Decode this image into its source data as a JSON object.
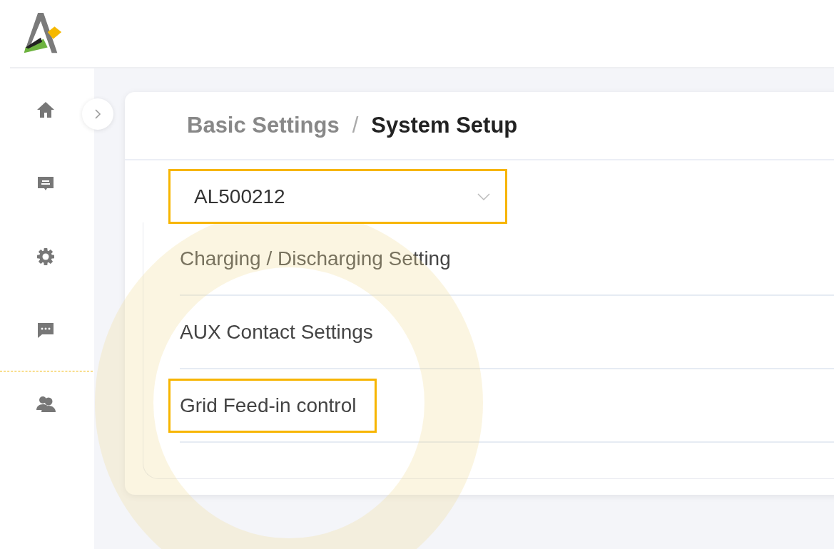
{
  "sidebar": {
    "items": [
      {
        "kind": "home"
      },
      {
        "kind": "book"
      },
      {
        "kind": "gear"
      },
      {
        "kind": "chat"
      },
      {
        "kind": "users"
      }
    ]
  },
  "breadcrumb": {
    "items": [
      {
        "label": "Basic Settings",
        "current": false
      },
      {
        "label": "System Setup",
        "current": true
      }
    ],
    "separator": "/"
  },
  "device_select": {
    "value": "AL500212",
    "highlighted": true
  },
  "settings_items": [
    {
      "label": "Charging / Discharging Setting",
      "highlighted": false
    },
    {
      "label": "AUX Contact Settings",
      "highlighted": false
    },
    {
      "label": "Grid Feed-in control",
      "highlighted": true
    }
  ]
}
